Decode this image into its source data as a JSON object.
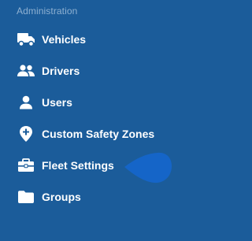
{
  "sidebar": {
    "section_title": "Administration",
    "items": [
      {
        "label": "Vehicles",
        "icon": "truck-icon"
      },
      {
        "label": "Drivers",
        "icon": "users-icon"
      },
      {
        "label": "Users",
        "icon": "user-icon"
      },
      {
        "label": "Custom Safety Zones",
        "icon": "map-pin-plus-icon"
      },
      {
        "label": "Fleet Settings",
        "icon": "briefcase-icon"
      },
      {
        "label": "Groups",
        "icon": "folder-icon"
      }
    ]
  },
  "colors": {
    "background": "#1b5c9a",
    "section_title": "#8fb1d2",
    "text": "#ffffff",
    "pointer": "#1565c8"
  }
}
